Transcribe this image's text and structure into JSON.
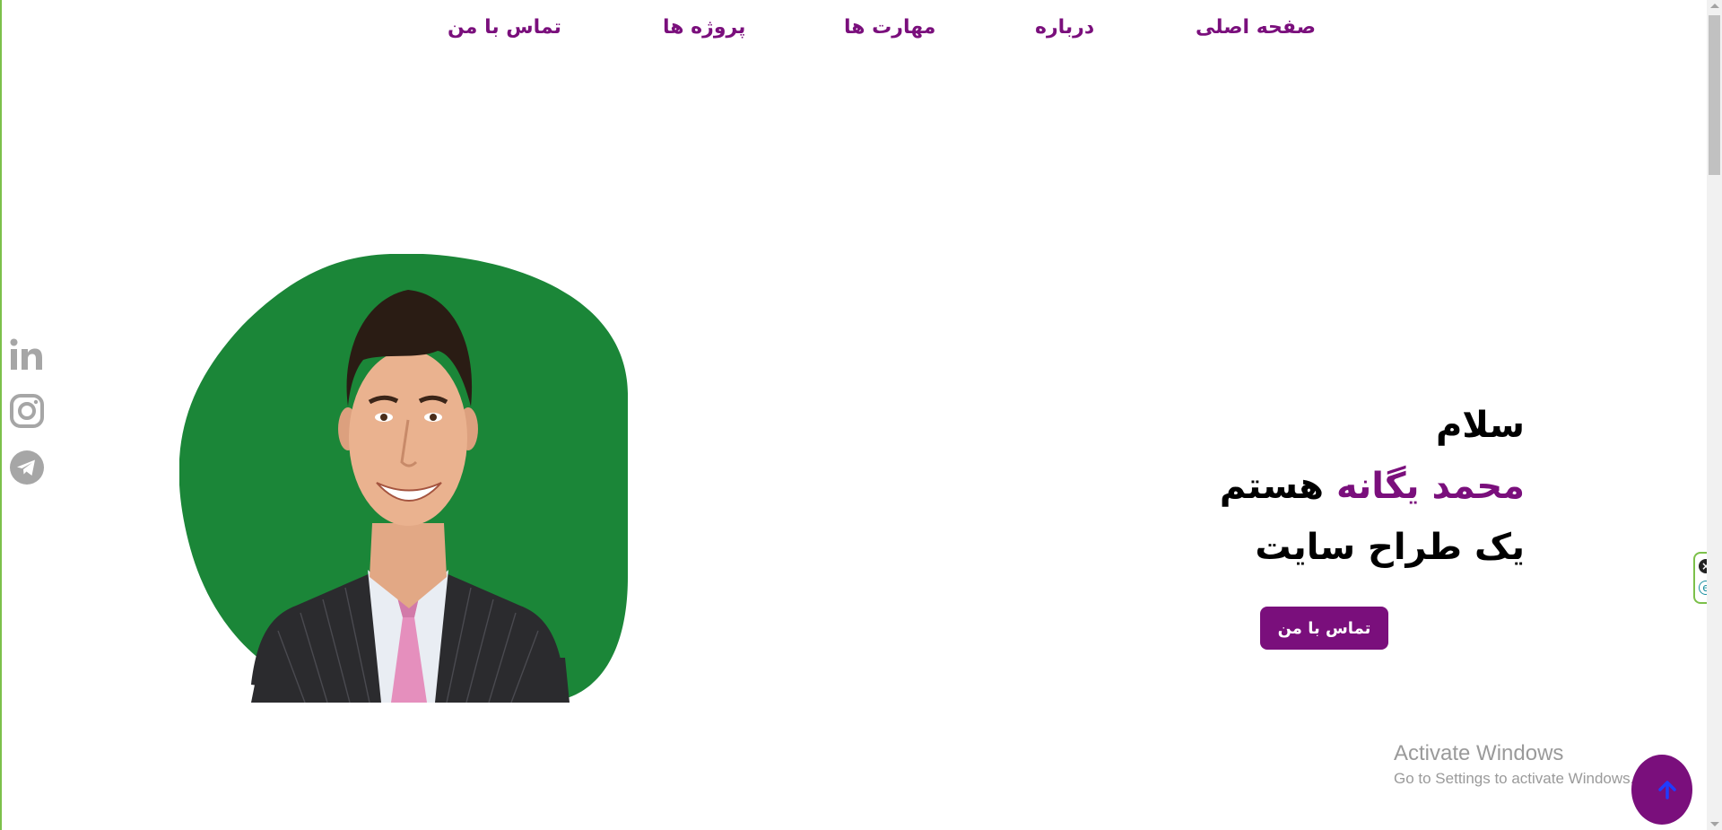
{
  "nav": {
    "home": "صفحه اصلی",
    "about": "درباره",
    "skills": "مهارت ها",
    "projects": "پروژه ها",
    "contact": "تماس با من"
  },
  "social": {
    "icons": [
      "linkedin-icon",
      "instagram-icon",
      "telegram-icon"
    ],
    "color": "#a6a6a6"
  },
  "hero": {
    "greeting": "سلام",
    "name": "محمد یگانه",
    "name_suffix": " هستم",
    "role": "یک طراح سایت",
    "button_label": "تماس با من"
  },
  "watermark": {
    "title": "Activate Windows",
    "subtitle": "Go to Settings to activate Windows."
  },
  "colors": {
    "accent": "#7a0f7c",
    "blob_green": "#1b8638",
    "arrow_blue": "#1f3cff"
  }
}
